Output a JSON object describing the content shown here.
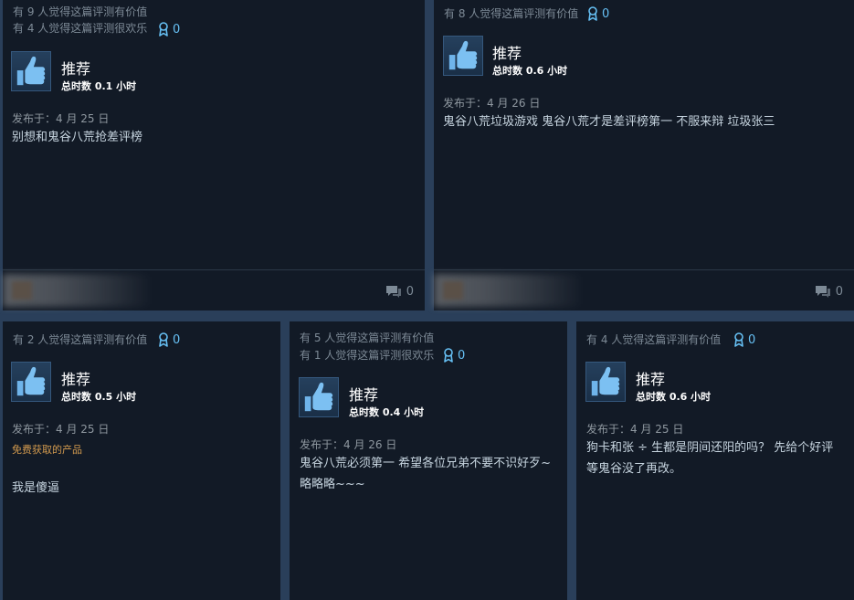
{
  "reviews": [
    {
      "helpful_text": "有 9 人觉得这篇评测有价值",
      "funny_text": "有 4 人觉得这篇评测很欢乐",
      "award_count": "0",
      "recommendation": "推荐",
      "hours": "总时数 0.1 小时",
      "posted": "发布于：4 月 25 日",
      "free_label": "",
      "content": "别想和鬼谷八荒抢差评榜",
      "comment_count": "0"
    },
    {
      "helpful_text": "有 8 人觉得这篇评测有价值",
      "funny_text": "",
      "award_count": "0",
      "recommendation": "推荐",
      "hours": "总时数 0.6 小时",
      "posted": "发布于：4 月 26 日",
      "free_label": "",
      "content": "鬼谷八荒垃圾游戏 鬼谷八荒才是差评榜第一 不服来辩 垃圾张三",
      "comment_count": "0"
    },
    {
      "helpful_text": "有 2 人觉得这篇评测有价值",
      "funny_text": "",
      "award_count": "0",
      "recommendation": "推荐",
      "hours": "总时数 0.5 小时",
      "posted": "发布于：4 月 25 日",
      "free_label": "免费获取的产品",
      "content": "我是傻逼",
      "comment_count": ""
    },
    {
      "helpful_text": "有 5 人觉得这篇评测有价值",
      "funny_text": "有 1 人觉得这篇评测很欢乐",
      "award_count": "0",
      "recommendation": "推荐",
      "hours": "总时数 0.4 小时",
      "posted": "发布于：4 月 26 日",
      "free_label": "",
      "content": "鬼谷八荒必须第一 希望各位兄弟不要不识好歹~ 略略略~~~",
      "comment_count": ""
    },
    {
      "helpful_text": "有 4 人觉得这篇评测有价值",
      "funny_text": "",
      "award_count": "0",
      "recommendation": "推荐",
      "hours": "总时数 0.6 小时",
      "posted": "发布于：4 月 25 日",
      "free_label": "",
      "content": "狗卡和张 ÷ 生都是阴间还阳的吗？ 先给个好评等鬼谷没了再改。",
      "comment_count": ""
    }
  ]
}
